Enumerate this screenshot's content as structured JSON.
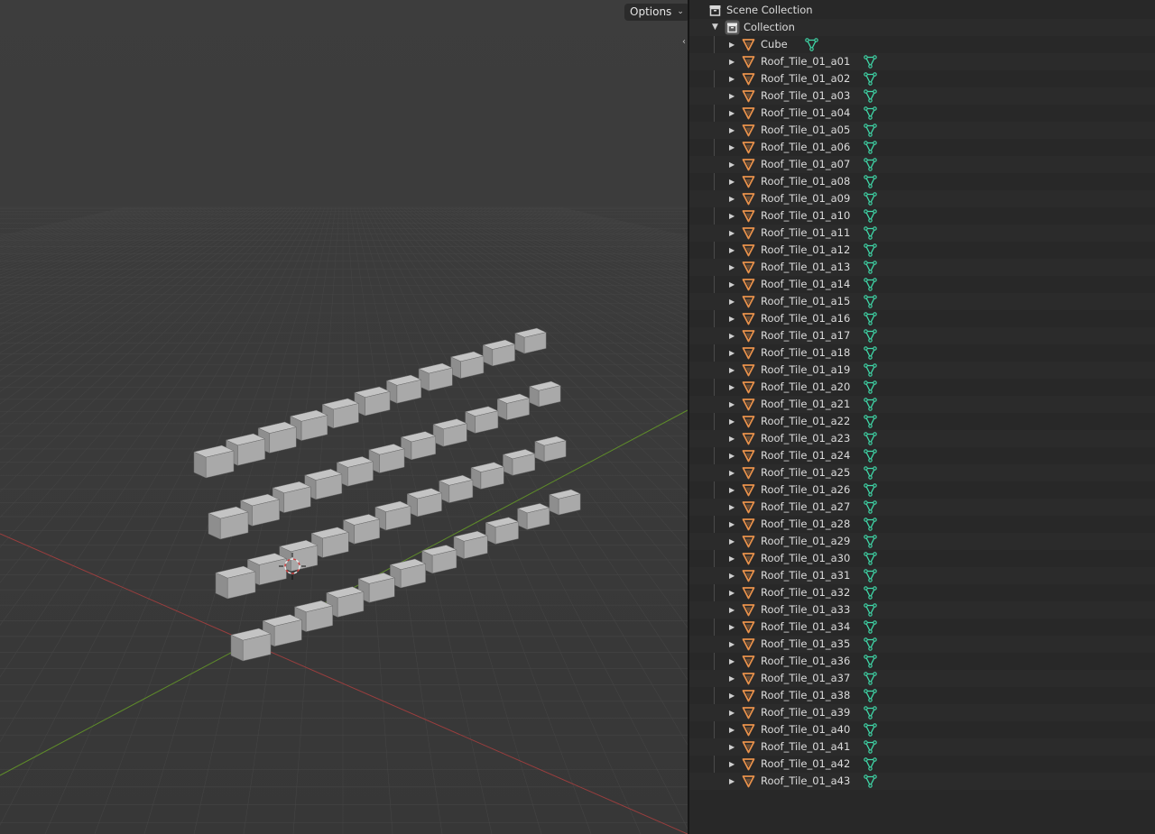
{
  "viewport": {
    "options_label": "Options",
    "collapse_glyph": "‹"
  },
  "outliner": {
    "scene_collection": {
      "label": "Scene Collection",
      "icon": "scene-collection-icon"
    },
    "collection": {
      "label": "Collection",
      "icon": "collection-icon",
      "expanded": true
    },
    "objects": [
      {
        "name": "Cube"
      },
      {
        "name": "Roof_Tile_01_a01"
      },
      {
        "name": "Roof_Tile_01_a02"
      },
      {
        "name": "Roof_Tile_01_a03"
      },
      {
        "name": "Roof_Tile_01_a04"
      },
      {
        "name": "Roof_Tile_01_a05"
      },
      {
        "name": "Roof_Tile_01_a06"
      },
      {
        "name": "Roof_Tile_01_a07"
      },
      {
        "name": "Roof_Tile_01_a08"
      },
      {
        "name": "Roof_Tile_01_a09"
      },
      {
        "name": "Roof_Tile_01_a10"
      },
      {
        "name": "Roof_Tile_01_a11"
      },
      {
        "name": "Roof_Tile_01_a12"
      },
      {
        "name": "Roof_Tile_01_a13"
      },
      {
        "name": "Roof_Tile_01_a14"
      },
      {
        "name": "Roof_Tile_01_a15"
      },
      {
        "name": "Roof_Tile_01_a16"
      },
      {
        "name": "Roof_Tile_01_a17"
      },
      {
        "name": "Roof_Tile_01_a18"
      },
      {
        "name": "Roof_Tile_01_a19"
      },
      {
        "name": "Roof_Tile_01_a20"
      },
      {
        "name": "Roof_Tile_01_a21"
      },
      {
        "name": "Roof_Tile_01_a22"
      },
      {
        "name": "Roof_Tile_01_a23"
      },
      {
        "name": "Roof_Tile_01_a24"
      },
      {
        "name": "Roof_Tile_01_a25"
      },
      {
        "name": "Roof_Tile_01_a26"
      },
      {
        "name": "Roof_Tile_01_a27"
      },
      {
        "name": "Roof_Tile_01_a28"
      },
      {
        "name": "Roof_Tile_01_a29"
      },
      {
        "name": "Roof_Tile_01_a30"
      },
      {
        "name": "Roof_Tile_01_a31"
      },
      {
        "name": "Roof_Tile_01_a32"
      },
      {
        "name": "Roof_Tile_01_a33"
      },
      {
        "name": "Roof_Tile_01_a34"
      },
      {
        "name": "Roof_Tile_01_a35"
      },
      {
        "name": "Roof_Tile_01_a36"
      },
      {
        "name": "Roof_Tile_01_a37"
      },
      {
        "name": "Roof_Tile_01_a38"
      },
      {
        "name": "Roof_Tile_01_a39"
      },
      {
        "name": "Roof_Tile_01_a40"
      },
      {
        "name": "Roof_Tile_01_a41"
      },
      {
        "name": "Roof_Tile_01_a42"
      },
      {
        "name": "Roof_Tile_01_a43"
      }
    ],
    "object_icon": "mesh-object-icon",
    "data_icon": "mesh-data-icon"
  },
  "colors": {
    "object_icon": "#e8914b",
    "mesh_data_icon": "#3fd7a8",
    "x_axis": "#b04848",
    "y_axis": "#6a9a2e",
    "viewport_bg": "#3b3b3b",
    "outliner_bg": "#282828"
  }
}
